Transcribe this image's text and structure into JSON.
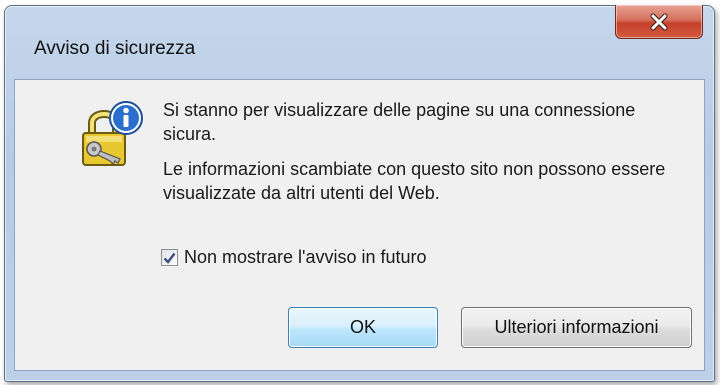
{
  "dialog": {
    "title": "Avviso di sicurezza",
    "close_icon": "close-icon"
  },
  "message": {
    "line1": "Si stanno per visualizzare delle pagine su una connessione sicura.",
    "line2": "Le informazioni scambiate con questo sito non possono essere visualizzate da altri utenti del Web."
  },
  "checkbox": {
    "label": "Non mostrare l'avviso in futuro",
    "checked": true
  },
  "buttons": {
    "ok_label": "OK",
    "more_label": "Ulteriori informazioni"
  },
  "icon": {
    "name": "lock-info-icon"
  },
  "colors": {
    "close_button": "#c4402a",
    "ok_button_border": "#3c7fb1",
    "lock": "#e8c830",
    "info_badge": "#2b6fce"
  }
}
